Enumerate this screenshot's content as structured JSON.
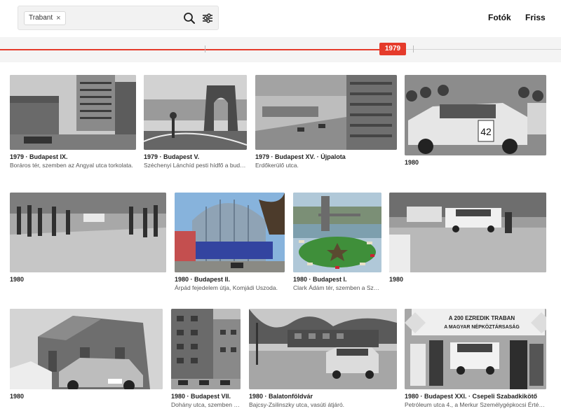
{
  "search": {
    "chip_label": "Trabant",
    "chip_remove": "×",
    "placeholder": ""
  },
  "nav": {
    "photos": "Fotók",
    "fresh": "Friss"
  },
  "timeline": {
    "year": "1979"
  },
  "photos": [
    {
      "title": "1979 · Budapest IX.",
      "subtitle": "Boráros tér, szemben az Angyal utca torkolata."
    },
    {
      "title": "1979 · Budapest V.",
      "subtitle": "Széchenyi Lánchíd pesti hídfő a budai..."
    },
    {
      "title": "1979 · Budapest XV. · Újpalota",
      "subtitle": "Erdőkerülő utca."
    },
    {
      "title": "1980",
      "subtitle": ""
    },
    {
      "title": "1980",
      "subtitle": ""
    },
    {
      "title": "1980 · Budapest II.",
      "subtitle": "Árpád fejedelem útja, Komjádi Uszoda."
    },
    {
      "title": "1980 · Budapest I.",
      "subtitle": "Clark Ádám tér, szemben a Szé..."
    },
    {
      "title": "1980",
      "subtitle": ""
    },
    {
      "title": "1980",
      "subtitle": ""
    },
    {
      "title": "1980 · Budapest VII.",
      "subtitle": "Dohány utca, szemben a..."
    },
    {
      "title": "1980 · Balatonföldvár",
      "subtitle": "Bajcsy-Zsilinszky utca, vasúti átjáró."
    },
    {
      "title": "1980 · Budapest XXI. · Csepeli Szabadkikötő",
      "subtitle": "Petróleum utca 4., a Merkur Személygépkocsi Értéke..."
    }
  ],
  "photo_signs": {
    "car_number": "42",
    "banner_line1": "A 200 EZREDIK TRABAN",
    "banner_line2": "A MAGYAR NÉPKÖZTÁRSASÁG"
  }
}
